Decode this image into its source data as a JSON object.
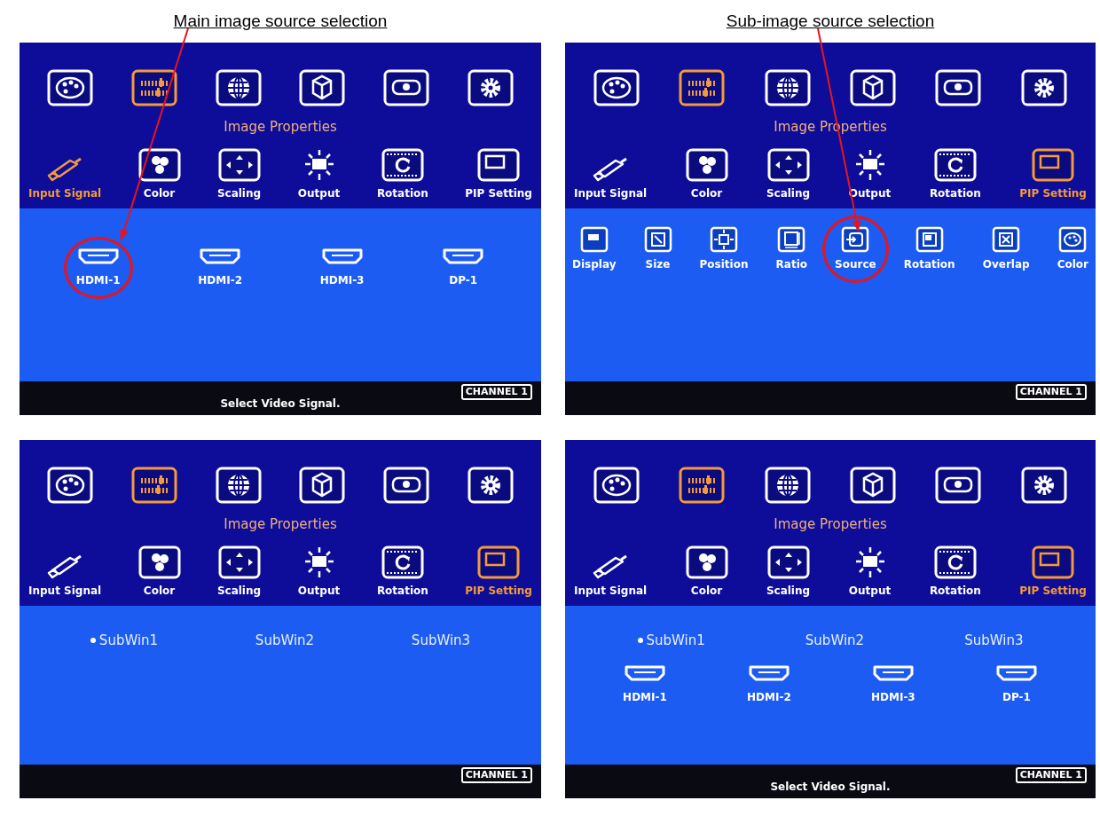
{
  "panels": [
    {
      "caption": "Main image source selection",
      "categories": [
        {
          "kind": "palette",
          "selected": false
        },
        {
          "kind": "sliders",
          "selected": true
        },
        {
          "kind": "globe",
          "selected": false
        },
        {
          "kind": "cube",
          "selected": false
        },
        {
          "kind": "projector",
          "selected": false
        },
        {
          "kind": "gear",
          "selected": false
        }
      ],
      "title": "Image Properties",
      "menu": [
        {
          "kind": "plug",
          "label": "Input Signal",
          "selected": true
        },
        {
          "kind": "rgb",
          "label": "Color",
          "selected": false
        },
        {
          "kind": "arrows",
          "label": "Scaling",
          "selected": false
        },
        {
          "kind": "monitor",
          "label": "Output",
          "selected": false
        },
        {
          "kind": "rotate",
          "label": "Rotation",
          "selected": false
        },
        {
          "kind": "pip",
          "label": "PIP Setting",
          "selected": false
        }
      ],
      "sections": [
        {
          "kind": "sources",
          "items": [
            {
              "label": "HDMI-1",
              "highlighted": true
            },
            {
              "label": "HDMI-2",
              "highlighted": false
            },
            {
              "label": "HDMI-3",
              "highlighted": false
            },
            {
              "label": "DP-1",
              "highlighted": false
            }
          ]
        }
      ],
      "status_text": "Select Video Signal.",
      "channel": "CHANNEL 1"
    },
    {
      "caption": "Sub-image source selection",
      "categories": [
        {
          "kind": "palette",
          "selected": false
        },
        {
          "kind": "sliders",
          "selected": true
        },
        {
          "kind": "globe",
          "selected": false
        },
        {
          "kind": "cube",
          "selected": false
        },
        {
          "kind": "projector",
          "selected": false
        },
        {
          "kind": "gear",
          "selected": false
        }
      ],
      "title": "Image Properties",
      "menu": [
        {
          "kind": "plug",
          "label": "Input Signal",
          "selected": false
        },
        {
          "kind": "rgb",
          "label": "Color",
          "selected": false
        },
        {
          "kind": "arrows",
          "label": "Scaling",
          "selected": false
        },
        {
          "kind": "monitor",
          "label": "Output",
          "selected": false
        },
        {
          "kind": "rotate",
          "label": "Rotation",
          "selected": false
        },
        {
          "kind": "pip",
          "label": "PIP Setting",
          "selected": true
        }
      ],
      "sections": [
        {
          "kind": "pip_options",
          "items": [
            {
              "kind": "display",
              "label": "Display",
              "highlighted": false
            },
            {
              "kind": "size",
              "label": "Size",
              "highlighted": false
            },
            {
              "kind": "position",
              "label": "Position",
              "highlighted": false
            },
            {
              "kind": "ratio",
              "label": "Ratio",
              "highlighted": false
            },
            {
              "kind": "source",
              "label": "Source",
              "highlighted": true
            },
            {
              "kind": "rotation",
              "label": "Rotation",
              "highlighted": false
            },
            {
              "kind": "overlap",
              "label": "Overlap",
              "highlighted": false
            },
            {
              "kind": "color",
              "label": "Color",
              "highlighted": false
            }
          ]
        }
      ],
      "channel": "CHANNEL 1"
    },
    {
      "categories": [
        {
          "kind": "palette",
          "selected": false
        },
        {
          "kind": "sliders",
          "selected": true
        },
        {
          "kind": "globe",
          "selected": false
        },
        {
          "kind": "cube",
          "selected": false
        },
        {
          "kind": "projector",
          "selected": false
        },
        {
          "kind": "gear",
          "selected": false
        }
      ],
      "title": "Image Properties",
      "menu": [
        {
          "kind": "plug",
          "label": "Input Signal",
          "selected": false
        },
        {
          "kind": "rgb",
          "label": "Color",
          "selected": false
        },
        {
          "kind": "arrows",
          "label": "Scaling",
          "selected": false
        },
        {
          "kind": "monitor",
          "label": "Output",
          "selected": false
        },
        {
          "kind": "rotate",
          "label": "Rotation",
          "selected": false
        },
        {
          "kind": "pip",
          "label": "PIP Setting",
          "selected": true
        }
      ],
      "sections": [
        {
          "kind": "subwindows",
          "items": [
            {
              "label": "SubWin1",
              "selected": true
            },
            {
              "label": "SubWin2",
              "selected": false
            },
            {
              "label": "SubWin3",
              "selected": false
            }
          ]
        }
      ],
      "channel": "CHANNEL 1"
    },
    {
      "categories": [
        {
          "kind": "palette",
          "selected": false
        },
        {
          "kind": "sliders",
          "selected": true
        },
        {
          "kind": "globe",
          "selected": false
        },
        {
          "kind": "cube",
          "selected": false
        },
        {
          "kind": "projector",
          "selected": false
        },
        {
          "kind": "gear",
          "selected": false
        }
      ],
      "title": "Image Properties",
      "menu": [
        {
          "kind": "plug",
          "label": "Input Signal",
          "selected": false
        },
        {
          "kind": "rgb",
          "label": "Color",
          "selected": false
        },
        {
          "kind": "arrows",
          "label": "Scaling",
          "selected": false
        },
        {
          "kind": "monitor",
          "label": "Output",
          "selected": false
        },
        {
          "kind": "rotate",
          "label": "Rotation",
          "selected": false
        },
        {
          "kind": "pip",
          "label": "PIP Setting",
          "selected": true
        }
      ],
      "sections": [
        {
          "kind": "subwindows",
          "items": [
            {
              "label": "SubWin1",
              "selected": true
            },
            {
              "label": "SubWin2",
              "selected": false
            },
            {
              "label": "SubWin3",
              "selected": false
            }
          ]
        },
        {
          "kind": "sources",
          "items": [
            {
              "label": "HDMI-1",
              "highlighted": false
            },
            {
              "label": "HDMI-2",
              "highlighted": false
            },
            {
              "label": "HDMI-3",
              "highlighted": false
            },
            {
              "label": "DP-1",
              "highlighted": false
            }
          ]
        }
      ],
      "status_text": "Select Video Signal.",
      "channel": "CHANNEL 1"
    }
  ]
}
